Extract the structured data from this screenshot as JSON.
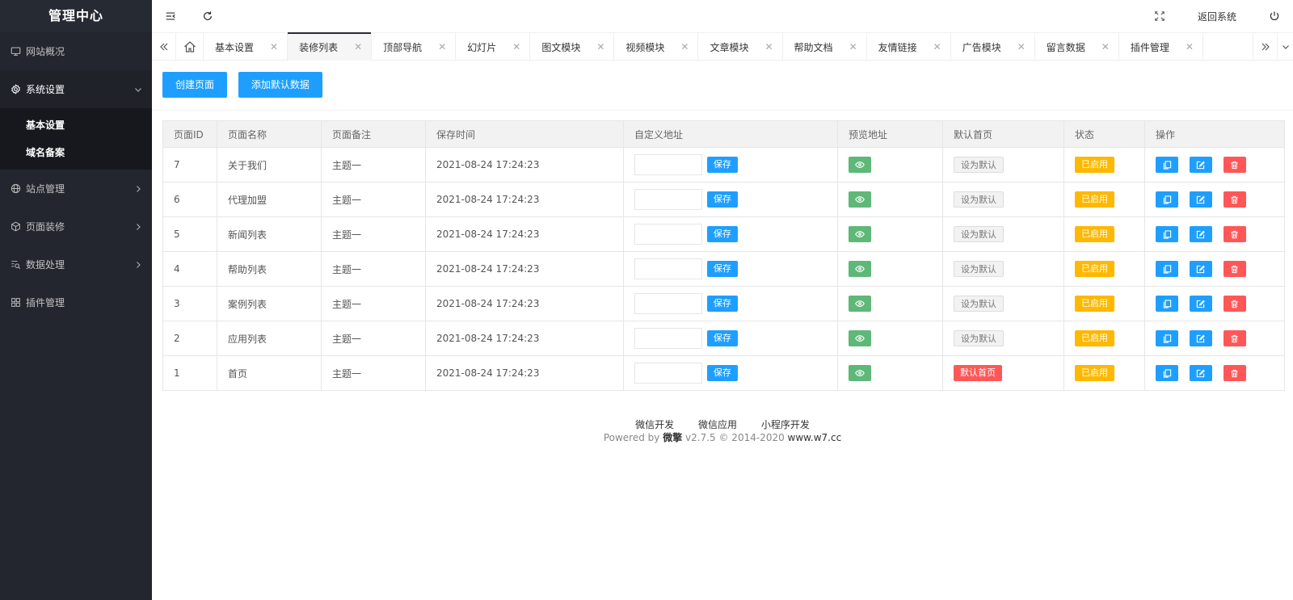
{
  "sidebar": {
    "title": "管理中心",
    "items": [
      {
        "label": "网站概况"
      },
      {
        "label": "系统设置"
      },
      {
        "label": "站点管理"
      },
      {
        "label": "页面装修"
      },
      {
        "label": "数据处理"
      },
      {
        "label": "插件管理"
      }
    ],
    "submenu": [
      {
        "label": "基本设置"
      },
      {
        "label": "域名备案"
      }
    ]
  },
  "header": {
    "back_label": "返回系统"
  },
  "tabs": [
    {
      "label": "基本设置"
    },
    {
      "label": "装修列表"
    },
    {
      "label": "顶部导航"
    },
    {
      "label": "幻灯片"
    },
    {
      "label": "图文模块"
    },
    {
      "label": "视频模块"
    },
    {
      "label": "文章模块"
    },
    {
      "label": "帮助文档"
    },
    {
      "label": "友情链接"
    },
    {
      "label": "广告模块"
    },
    {
      "label": "留言数据"
    },
    {
      "label": "插件管理"
    }
  ],
  "toolbar": {
    "create_label": "创建页面",
    "add_default_label": "添加默认数据"
  },
  "table": {
    "headers": [
      "页面ID",
      "页面名称",
      "页面备注",
      "保存时间",
      "自定义地址",
      "预览地址",
      "默认首页",
      "状态",
      "操作"
    ],
    "save_label": "保存",
    "set_default_label": "设为默认",
    "is_default_label": "默认首页",
    "status_label": "已启用",
    "rows": [
      {
        "id": "7",
        "name": "关于我们",
        "note": "主题一",
        "time": "2021-08-24 17:24:23"
      },
      {
        "id": "6",
        "name": "代理加盟",
        "note": "主题一",
        "time": "2021-08-24 17:24:23"
      },
      {
        "id": "5",
        "name": "新闻列表",
        "note": "主题一",
        "time": "2021-08-24 17:24:23"
      },
      {
        "id": "4",
        "name": "帮助列表",
        "note": "主题一",
        "time": "2021-08-24 17:24:23"
      },
      {
        "id": "3",
        "name": "案例列表",
        "note": "主题一",
        "time": "2021-08-24 17:24:23"
      },
      {
        "id": "2",
        "name": "应用列表",
        "note": "主题一",
        "time": "2021-08-24 17:24:23"
      },
      {
        "id": "1",
        "name": "首页",
        "note": "主题一",
        "time": "2021-08-24 17:24:23"
      }
    ]
  },
  "footer": {
    "links": [
      "微信开发",
      "微信应用",
      "小程序开发"
    ],
    "powered_prefix": "Powered by",
    "brand": "微擎",
    "version": "v2.7.5 © 2014-2020",
    "site": "www.w7.cc"
  },
  "colors": {
    "primary": "#1e9fff",
    "success": "#5fb878",
    "danger": "#ff5757",
    "warning": "#ffb800",
    "sidebar_bg": "#23262e"
  }
}
